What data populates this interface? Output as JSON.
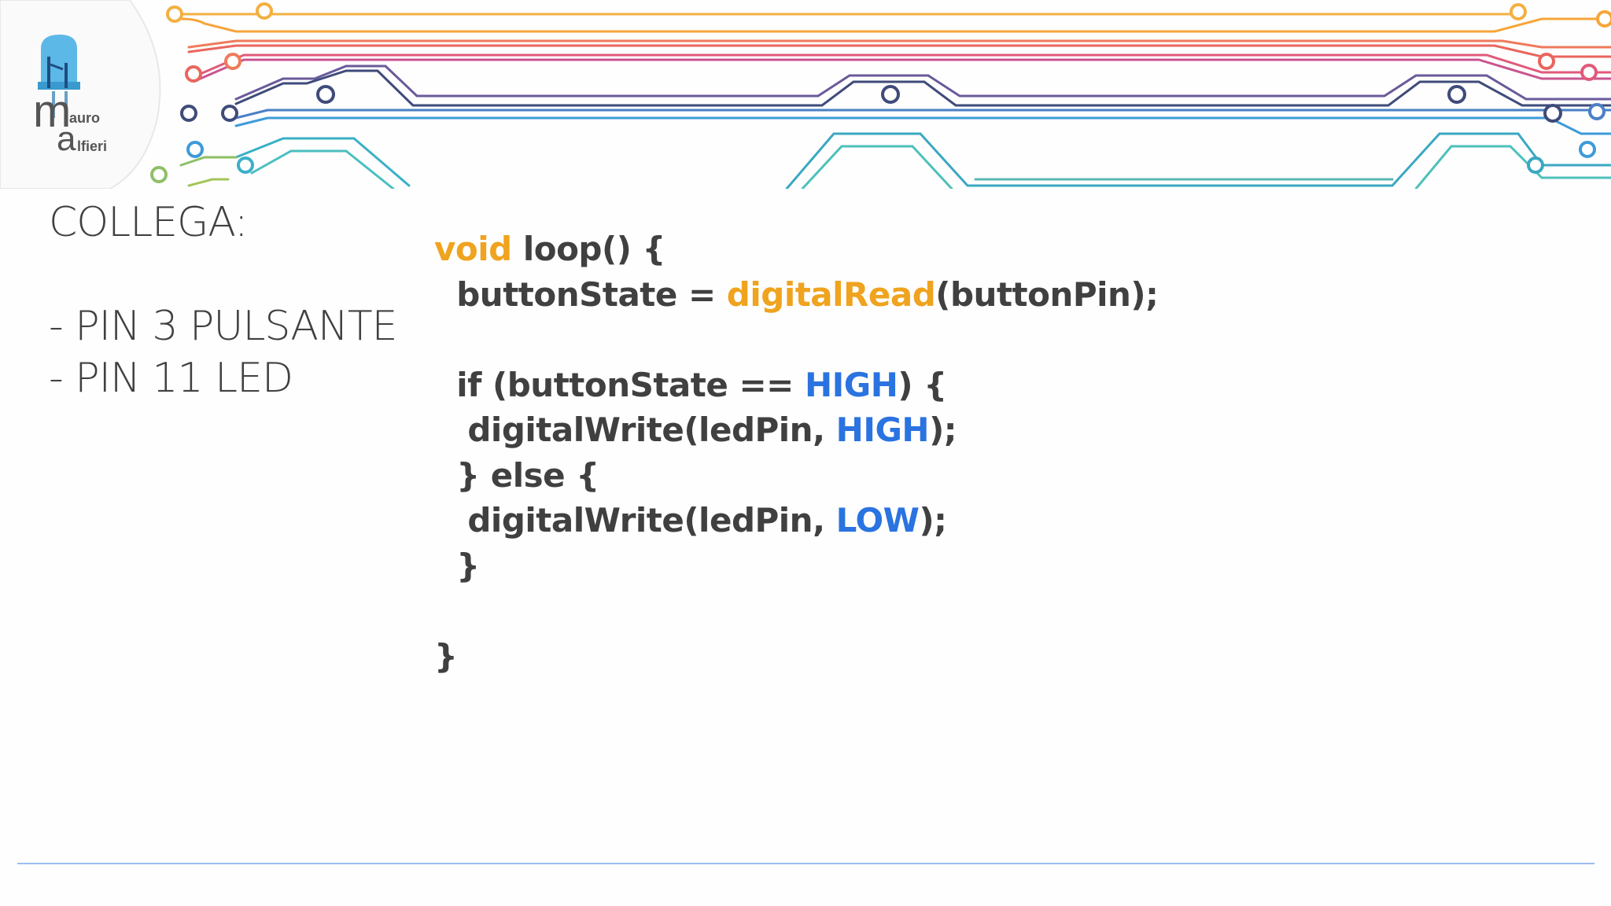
{
  "logo": {
    "letter_m": "m",
    "suffix_m": "auro",
    "letter_a": "a",
    "suffix_a": "lfieri"
  },
  "instructions": {
    "heading": "COLLEGA:",
    "items": [
      "- PIN 3 PULSANTE",
      "- PIN 11 LED"
    ]
  },
  "code": {
    "line1": {
      "kw": "void",
      "rest": " loop() {"
    },
    "line2": {
      "pre": "  buttonState = ",
      "fn": "digitalRead",
      "post": "(buttonPin);"
    },
    "line4": {
      "pre": "  if (buttonState == ",
      "const": "HIGH",
      "post": ") {"
    },
    "line5": {
      "pre": "   digitalWrite(ledPin, ",
      "const": "HIGH",
      "post": ");"
    },
    "line6": {
      "text": "  } else {"
    },
    "line7": {
      "pre": "   digitalWrite(ledPin, ",
      "const": "LOW",
      "post": ");"
    },
    "line8": {
      "text": "  }"
    },
    "line10": {
      "text": "}"
    }
  },
  "colors": {
    "keyword": "#f0a31e",
    "constant": "#2a73e0",
    "text": "#404040",
    "rule": "#9bbdf0"
  }
}
